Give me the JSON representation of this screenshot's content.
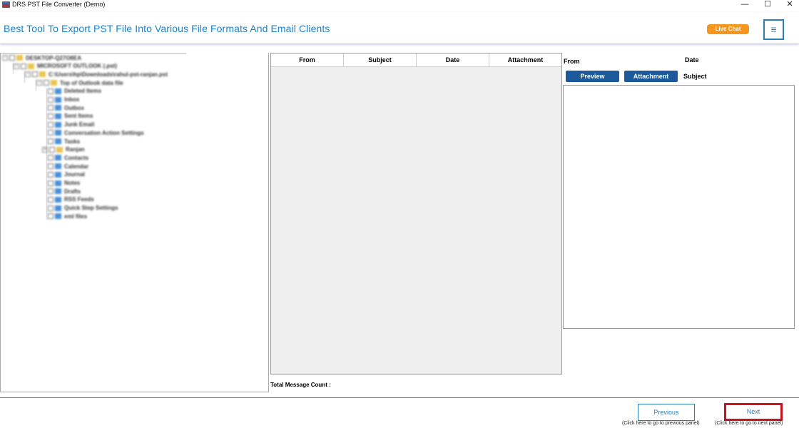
{
  "window": {
    "title": "DRS PST File Converter (Demo)",
    "controls": {
      "minimize": "—",
      "maximize": "☐",
      "close": "✕"
    }
  },
  "header": {
    "title": "Best Tool To Export PST File Into Various File Formats And Email Clients",
    "live_chat": "Live Chat",
    "menu_icon": "≡"
  },
  "tree": {
    "items": [
      {
        "label": "DESKTOP-Q27O8EA",
        "folder": "yellow"
      },
      {
        "label": "MICROSOFT OUTLOOK (.pst)",
        "folder": "yellow"
      },
      {
        "label": "C:\\Users\\hp\\Downloads\\rahul-pst-ranjan.pst",
        "folder": "yellow"
      },
      {
        "label": "Top of Outlook data file",
        "folder": "yellow"
      },
      {
        "label": "Deleted Items",
        "folder": "blue"
      },
      {
        "label": "Inbox",
        "folder": "blue"
      },
      {
        "label": "Outbox",
        "folder": "blue"
      },
      {
        "label": "Sent Items",
        "folder": "blue"
      },
      {
        "label": "Junk Email",
        "folder": "blue"
      },
      {
        "label": "Conversation Action Settings",
        "folder": "blue"
      },
      {
        "label": "Tasks",
        "folder": "blue"
      },
      {
        "label": "Ranjan",
        "folder": "yellow"
      },
      {
        "label": "Contacts",
        "folder": "blue"
      },
      {
        "label": "Calendar",
        "folder": "blue"
      },
      {
        "label": "Journal",
        "folder": "blue"
      },
      {
        "label": "Notes",
        "folder": "blue"
      },
      {
        "label": "Drafts",
        "folder": "blue"
      },
      {
        "label": "RSS Feeds",
        "folder": "blue"
      },
      {
        "label": "Quick Step Settings",
        "folder": "blue"
      },
      {
        "label": "eml files",
        "folder": "blue"
      }
    ]
  },
  "message_list": {
    "columns": [
      "From",
      "Subject",
      "Date",
      "Attachment"
    ],
    "rows": [],
    "total_label": "Total Message Count :"
  },
  "preview": {
    "from_label": "From",
    "date_label": "Date",
    "subject_label": "Subject",
    "preview_button": "Preview",
    "attachment_button": "Attachment"
  },
  "footer": {
    "previous": "Previous",
    "previous_hint": "(Click here to go to previous panel)",
    "next": "Next",
    "next_hint": "(Click here to go to next panel)"
  }
}
